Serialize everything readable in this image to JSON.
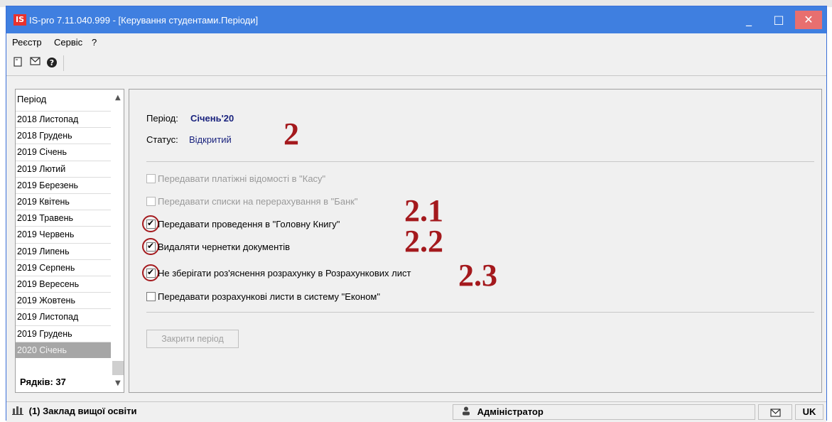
{
  "window": {
    "app_icon_text": "IS",
    "title": "IS-pro 7.11.040.999 - [Керування студентами.Періоди]",
    "minimize_glyph": "_",
    "maximize_glyph": "□",
    "close_glyph": "✕"
  },
  "menubar": {
    "items": [
      "Реєстр",
      "Сервіс",
      "?"
    ]
  },
  "toolbar": {
    "icons": [
      "document-icon",
      "envelope-icon",
      "help-icon"
    ]
  },
  "periods_list": {
    "header": "Період",
    "items": [
      "2018 Листопад",
      "2018 Грудень",
      "2019 Січень",
      "2019 Лютий",
      "2019 Березень",
      "2019 Квітень",
      "2019 Травень",
      "2019 Червень",
      "2019 Липень",
      "2019 Серпень",
      "2019 Вересень",
      "2019 Жовтень",
      "2019 Листопад",
      "2019 Грудень",
      "2020 Січень"
    ],
    "selected_index": 14,
    "footer": "Рядків: 37"
  },
  "details": {
    "period_label": "Період:",
    "period_value": "Січень'20",
    "status_label": "Статус:",
    "status_value": "Відкритий",
    "options": [
      {
        "label": "Передавати платіжні відомості в \"Касу\"",
        "checked": false,
        "enabled": false
      },
      {
        "label": "Передавати списки на перерахування в \"Банк\"",
        "checked": false,
        "enabled": false
      },
      {
        "label": "Передавати проведення в \"Головну Книгу\"",
        "checked": true,
        "enabled": true
      },
      {
        "label": "Видаляти чернетки документів",
        "checked": true,
        "enabled": true
      },
      {
        "label": "Не зберігати роз'яснення розрахунку в Розрахункових лист",
        "checked": true,
        "enabled": true
      },
      {
        "label": "Передавати розрахункові листи в систему \"Економ\"",
        "checked": false,
        "enabled": true
      }
    ],
    "close_period_button": "Закрити період"
  },
  "annotations": [
    "2",
    "2.1",
    "2.2",
    "2.3"
  ],
  "annotation_color": "#a4191d",
  "statusbar": {
    "institution": "(1) Заклад вищої освіти",
    "user": "Адміністратор",
    "language": "UK"
  }
}
